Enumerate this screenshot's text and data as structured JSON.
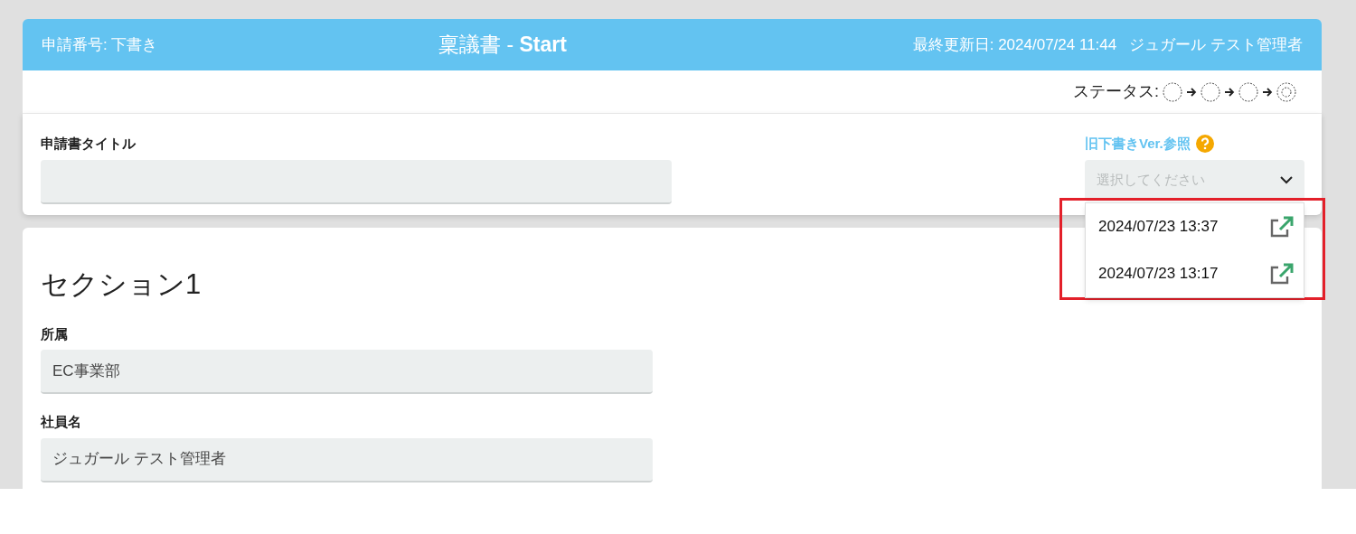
{
  "header": {
    "application_number": "申請番号: 下書き",
    "title": "稟議書 - **Start**",
    "last_updated": "最終更新日: 2024/07/24 11:44",
    "user": "ジュガール テスト管理者"
  },
  "status": {
    "label": "ステータス:",
    "steps": [
      {
        "kind": "circle"
      },
      {
        "kind": "circle"
      },
      {
        "kind": "circle"
      },
      {
        "kind": "double"
      }
    ]
  },
  "title_field": {
    "label": "申請書タイトル"
  },
  "draft_versions": {
    "label": "旧下書きVer.参照",
    "placeholder": "選択してください",
    "expanded": true,
    "options": [
      {
        "label": "2024/07/23 13:37"
      },
      {
        "label": "2024/07/23 13:17"
      }
    ]
  },
  "section": {
    "title": "セクション1",
    "fields": [
      {
        "label": "所属",
        "value": "EC事業部"
      },
      {
        "label": "社員名",
        "value": "ジュガール テスト管理者"
      }
    ]
  }
}
